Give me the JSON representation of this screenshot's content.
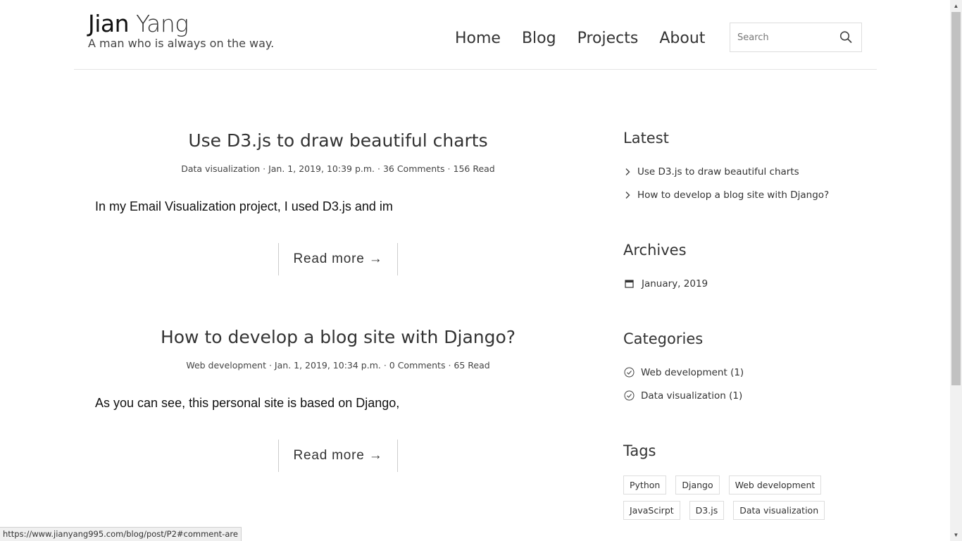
{
  "site": {
    "title_first": "Jian",
    "title_last": "Yang",
    "tagline": "A man who is always on the way."
  },
  "nav": {
    "items": [
      {
        "label": "Home"
      },
      {
        "label": "Blog"
      },
      {
        "label": "Projects"
      },
      {
        "label": "About"
      }
    ]
  },
  "search": {
    "placeholder": "Search",
    "icon": "search-icon"
  },
  "posts": [
    {
      "title": "Use D3.js to draw beautiful charts",
      "category": "Data visualization",
      "date": "Jan. 1, 2019, 10:39 p.m.",
      "comments": "36 Comments",
      "reads": "156 Read",
      "excerpt": "In my Email Visualization project, I used D3.js and im",
      "read_more": "Read more →"
    },
    {
      "title": "How to develop a blog site with Django?",
      "category": "Web development",
      "date": "Jan. 1, 2019, 10:34 p.m.",
      "comments": "0 Comments",
      "reads": "65 Read",
      "excerpt": "As you can see, this personal site is based on Django,",
      "read_more": "Read more →"
    }
  ],
  "meta_separator": " · ",
  "sidebar": {
    "latest": {
      "title": "Latest",
      "icon": "chevron-right-icon",
      "items": [
        {
          "label": "Use D3.js to draw beautiful charts"
        },
        {
          "label": "How to develop a blog site with Django?"
        }
      ]
    },
    "archives": {
      "title": "Archives",
      "icon": "calendar-icon",
      "items": [
        {
          "label": "January, 2019"
        }
      ]
    },
    "categories": {
      "title": "Categories",
      "icon": "check-circle-icon",
      "items": [
        {
          "label": "Web development (1)"
        },
        {
          "label": "Data visualization (1)"
        }
      ]
    },
    "tags": {
      "title": "Tags",
      "items": [
        {
          "label": "Python"
        },
        {
          "label": "Django"
        },
        {
          "label": "Web development"
        },
        {
          "label": "JavaScirpt"
        },
        {
          "label": "D3.js"
        },
        {
          "label": "Data visualization"
        }
      ]
    }
  },
  "status_bar": {
    "url": "https://www.jianyang995.com/blog/post/P2#comment-are"
  },
  "colors": {
    "text": "#333333",
    "border": "#dddddd",
    "background": "#ffffff"
  }
}
